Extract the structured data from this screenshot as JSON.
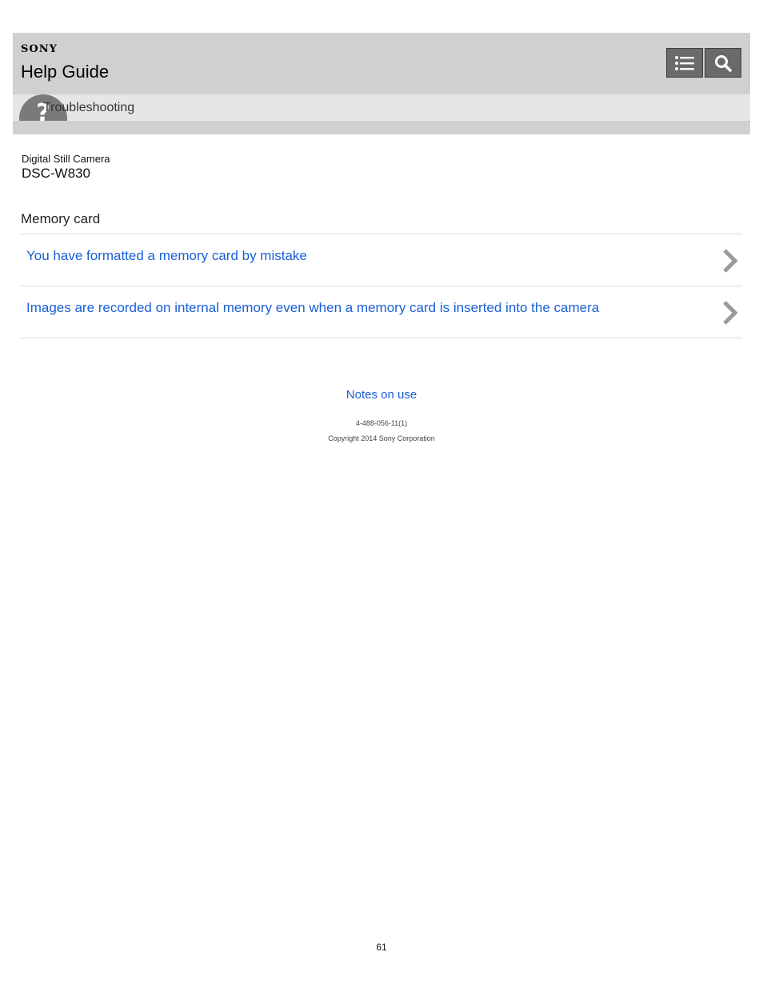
{
  "header": {
    "brand": "SONY",
    "title": "Help Guide",
    "menu_icon": "list-icon",
    "search_icon": "search-icon"
  },
  "breadcrumb": {
    "icon": "question-icon",
    "label": "Troubleshooting"
  },
  "product": {
    "type": "Digital Still Camera",
    "model": "DSC-W830"
  },
  "section": {
    "title": "Memory card",
    "items": [
      {
        "label": "You have formatted a memory card by mistake"
      },
      {
        "label": "Images are recorded on internal memory even when a memory card is inserted into the camera"
      }
    ]
  },
  "footer": {
    "notes_link": "Notes on use",
    "doc_id": "4-488-056-11(1)",
    "copyright": "Copyright 2014 Sony Corporation"
  },
  "page_number": "61",
  "colors": {
    "link": "#1a5fd6",
    "header_bg": "#d0d0d0",
    "button_bg": "#6a6a6a"
  }
}
